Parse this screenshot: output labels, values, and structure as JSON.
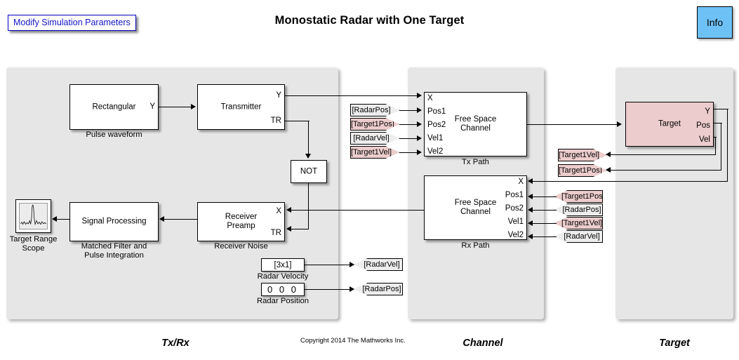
{
  "header": {
    "modify_button": "Modify Simulation Parameters",
    "title": "Monostatic Radar with One Target",
    "info_button": "Info"
  },
  "panels": {
    "txrx_caption": "Tx/Rx",
    "channel_caption": "Channel",
    "target_caption": "Target"
  },
  "blocks": {
    "pulse": {
      "name": "Rectangular",
      "out_y": "Y",
      "label": "Pulse waveform"
    },
    "transmitter": {
      "name": "Transmitter",
      "out_y": "Y",
      "out_tr": "TR"
    },
    "not_gate": {
      "name": "NOT"
    },
    "receiver": {
      "name": "Receiver\nPreamp",
      "line1": "Receiver",
      "line2": "Preamp",
      "in_x": "X",
      "in_tr": "TR",
      "label": "Receiver Noise"
    },
    "signal_processing": {
      "name": "Signal Processing",
      "label_line1": "Matched Filter and",
      "label_line2": "Pulse Integration"
    },
    "scope": {
      "label_line1": "Target Range",
      "label_line2": "Scope"
    },
    "tx_path": {
      "line1": "Free Space",
      "line2": "Channel",
      "label": "Tx Path",
      "ports": [
        "X",
        "Pos1",
        "Pos2",
        "Vel1",
        "Vel2"
      ]
    },
    "rx_path": {
      "line1": "Free Space",
      "line2": "Channel",
      "label": "Rx Path",
      "ports": [
        "X",
        "Pos1",
        "Pos2",
        "Vel1",
        "Vel2"
      ]
    },
    "target": {
      "name": "Target",
      "out_y": "Y",
      "out_pos": "Pos",
      "out_vel": "Vel"
    }
  },
  "constants": {
    "radar_velocity": {
      "value": "[3x1]",
      "label": "Radar Velocity"
    },
    "radar_position": {
      "value": "0   0   0",
      "label": "Radar Position"
    }
  },
  "tags": {
    "tx_from": [
      {
        "text": "[RadarPos]",
        "kind": "radar"
      },
      {
        "text": "[Target1Pos]",
        "kind": "target"
      },
      {
        "text": "[RadarVel]",
        "kind": "radar"
      },
      {
        "text": "[Target1Vel]",
        "kind": "target"
      }
    ],
    "rx_from": [
      {
        "text": "[Target1Pos]",
        "kind": "target"
      },
      {
        "text": "[RadarPos]",
        "kind": "radar"
      },
      {
        "text": "[Target1Vel]",
        "kind": "target"
      },
      {
        "text": "[RadarVel]",
        "kind": "radar"
      }
    ],
    "radar_goto": [
      {
        "text": "[RadarVel]",
        "kind": "radar"
      },
      {
        "text": "[RadarPos]",
        "kind": "radar"
      }
    ],
    "target_goto": [
      {
        "text": "[Target1Vel]",
        "kind": "target"
      },
      {
        "text": "[Target1Pos]",
        "kind": "target"
      }
    ]
  },
  "footer": {
    "copyright": "Copyright 2014 The Mathworks Inc."
  },
  "colors": {
    "panel_fill": "#e6e6e6",
    "target_block_fill": "#eccccc",
    "tag_radar_fill": "#ededed",
    "tag_target_fill": "#eccccc",
    "info_fill": "#6ec1f5",
    "modify_border": "#0000c0",
    "modify_text": "#1414c8"
  }
}
